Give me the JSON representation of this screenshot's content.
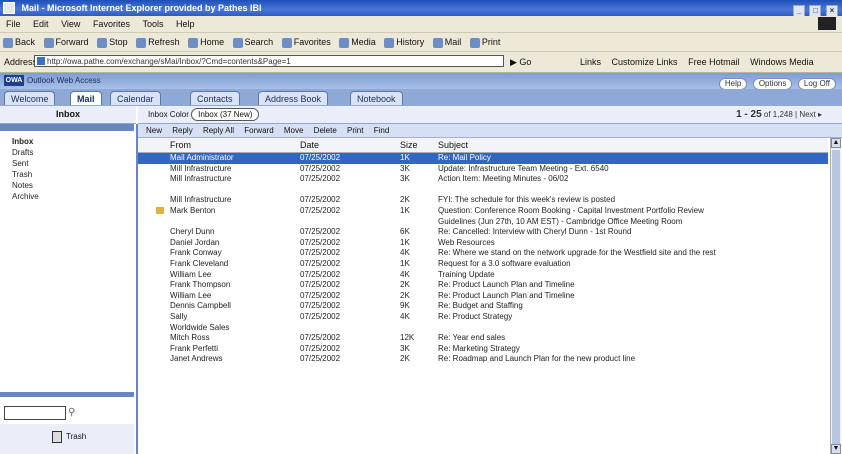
{
  "window": {
    "title": "Mail - Microsoft Internet Explorer provided by Pathes IBI",
    "buttons": [
      "_",
      "□",
      "×"
    ]
  },
  "menu": [
    "File",
    "Edit",
    "View",
    "Favorites",
    "Tools",
    "Help"
  ],
  "toolbar": [
    "Back",
    "Forward",
    "Stop",
    "Refresh",
    "Home",
    "Search",
    "Favorites",
    "Media",
    "History",
    "Mail",
    "Print"
  ],
  "address": {
    "label": "Address",
    "value": "http://owa.pathe.com/exchange/sMai/Inbox/?Cmd=contents&Page=1",
    "go": "Go",
    "links_label": "Links",
    "links": [
      "Customize Links",
      "Free Hotmail",
      "Windows Media"
    ]
  },
  "app": {
    "logo": "OWA",
    "name": "Outlook Web Access",
    "header_buttons": [
      "Help",
      "Options",
      "Log Off"
    ]
  },
  "tabs": [
    "Welcome",
    "Mail",
    "Calendar",
    "Contacts",
    "Address Book",
    "Notebook"
  ],
  "sidebar": {
    "header": "Inbox",
    "folders": [
      "Inbox",
      "Drafts",
      "Sent",
      "Trash",
      "Notes",
      "Archive"
    ],
    "trash_label": "Trash"
  },
  "main": {
    "box_label": "Inbox Color",
    "box_value": "Inbox (37 New)",
    "count": "1 - 25",
    "count_detail": "of 1,248 | Next ▸",
    "actions": [
      "New",
      "Reply",
      "Reply All",
      "Forward",
      "Move",
      "Delete",
      "Print",
      "Find"
    ],
    "columns": {
      "from": "From",
      "date": "Date",
      "size": "Size",
      "subject": "Subject"
    },
    "rows": [
      {
        "from": "Mail Administrator",
        "date": "07/25/2002",
        "size": "1K",
        "subject": "Re: Mail Policy",
        "selected": true
      },
      {
        "from": "Mill Infrastructure",
        "date": "07/25/2002",
        "size": "3K",
        "subject": "Update: Infrastructure Team Meeting - Ext. 6540",
        "selected": false
      },
      {
        "from": "Mill Infrastructure",
        "date": "07/25/2002",
        "size": "3K",
        "subject": "Action Item: Meeting Minutes - 06/02",
        "selected": false
      },
      {
        "from": "",
        "date": "",
        "size": "",
        "subject": "",
        "selected": false
      },
      {
        "from": "Mill Infrastructure",
        "date": "07/25/2002",
        "size": "2K",
        "subject": "FYI: The schedule for this week's review is posted",
        "selected": false
      },
      {
        "from": "Mark Benton",
        "date": "07/25/2002",
        "size": "1K",
        "subject": "Question: Conference Room Booking - Capital Investment Portfolio Review",
        "selected": false,
        "flag": true
      },
      {
        "from": "",
        "date": "",
        "size": "",
        "subject": "Guidelines (Jun 27th, 10 AM EST) - Cambridge Office Meeting Room",
        "selected": false
      },
      {
        "from": "Cheryl Dunn",
        "date": "07/25/2002",
        "size": "6K",
        "subject": "Re: Cancelled: Interview with Cheryl Dunn - 1st Round",
        "selected": false
      },
      {
        "from": "Daniel Jordan",
        "date": "07/25/2002",
        "size": "1K",
        "subject": "Web Resources",
        "selected": false
      },
      {
        "from": "Frank Conway",
        "date": "07/25/2002",
        "size": "4K",
        "subject": "Re: Where we stand on the network upgrade for the Westfield site and the rest",
        "selected": false
      },
      {
        "from": "Frank Cleveland",
        "date": "07/25/2002",
        "size": "1K",
        "subject": "Request for a 3.0 software evaluation",
        "selected": false
      },
      {
        "from": "William Lee",
        "date": "07/25/2002",
        "size": "4K",
        "subject": "Training Update",
        "selected": false
      },
      {
        "from": "Frank Thompson",
        "date": "07/25/2002",
        "size": "2K",
        "subject": "Re: Product Launch Plan and Timeline",
        "selected": false
      },
      {
        "from": "William Lee",
        "date": "07/25/2002",
        "size": "2K",
        "subject": "Re: Product Launch Plan and Timeline",
        "selected": false
      },
      {
        "from": "Dennis Campbell",
        "date": "07/25/2002",
        "size": "9K",
        "subject": "Re: Budget and Staffing",
        "selected": false
      },
      {
        "from": "Sally",
        "date": "07/25/2002",
        "size": "4K",
        "subject": "Re: Product Strategy",
        "selected": false
      },
      {
        "from": "Worldwide Sales",
        "date": "",
        "size": "",
        "subject": "",
        "selected": false
      },
      {
        "from": "Mitch Ross",
        "date": "07/25/2002",
        "size": "12K",
        "subject": "Re: Year end sales",
        "selected": false
      },
      {
        "from": "Frank Perfetti",
        "date": "07/25/2002",
        "size": "3K",
        "subject": "Re: Marketing Strategy",
        "selected": false
      },
      {
        "from": "Janet Andrews",
        "date": "07/25/2002",
        "size": "2K",
        "subject": "Re: Roadmap and Launch Plan for the new product line",
        "selected": false
      }
    ]
  }
}
